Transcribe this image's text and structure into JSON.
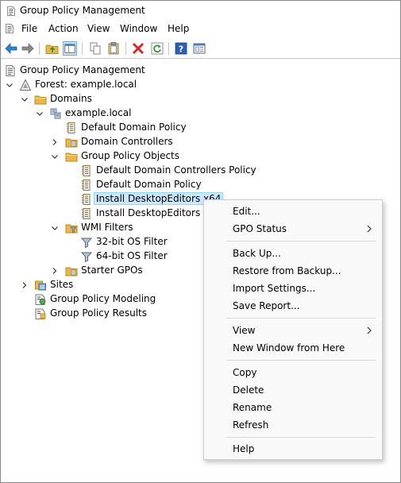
{
  "window": {
    "title": "Group Policy Management"
  },
  "menu": [
    "File",
    "Action",
    "View",
    "Window",
    "Help"
  ],
  "toolbar": [
    "back",
    "forward",
    "up-folder",
    "show-hide-tree",
    "copy",
    "paste",
    "delete",
    "refresh",
    "help",
    "properties"
  ],
  "tree": {
    "root": "Group Policy Management",
    "forest": "Forest: example.local",
    "domains": "Domains",
    "domain": "example.local",
    "default_domain_policy": "Default Domain Policy",
    "domain_controllers": "Domain Controllers",
    "gpo_container": "Group Policy Objects",
    "gpos": [
      "Default Domain Controllers Policy",
      "Default Domain Policy",
      "Install DesktopEditors x64",
      "Install DesktopEditors x86"
    ],
    "wmi_filters": "WMI Filters",
    "wmi_items": [
      "32-bit OS Filter",
      "64-bit OS Filter"
    ],
    "starter_gpos": "Starter GPOs",
    "sites": "Sites",
    "modeling": "Group Policy Modeling",
    "results": "Group Policy Results",
    "selected": "Install DesktopEditors x64"
  },
  "context_menu": {
    "edit": "Edit...",
    "gpo_status": "GPO Status",
    "back_up": "Back Up...",
    "restore": "Restore from Backup...",
    "import": "Import Settings...",
    "save_report": "Save Report...",
    "view": "View",
    "new_window": "New Window from Here",
    "copy": "Copy",
    "delete": "Delete",
    "rename": "Rename",
    "refresh": "Refresh",
    "help": "Help"
  },
  "colors": {
    "selection_bg": "#cce8ff",
    "selection_border": "#99d1ff",
    "accent_blue": "#1e6fd9",
    "delete_red": "#d9262a",
    "folder_yellow": "#e8b84a"
  }
}
